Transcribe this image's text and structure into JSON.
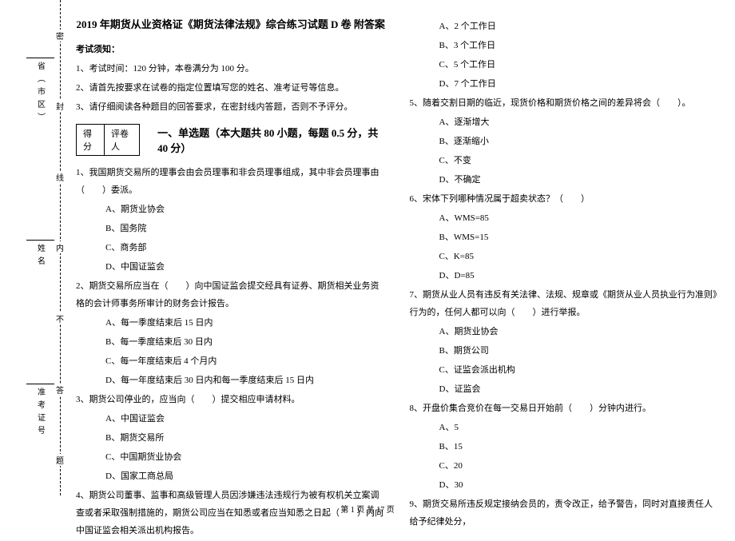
{
  "vertical_labels": {
    "province": "省（市区）",
    "name": "姓名",
    "ticket": "准考证号"
  },
  "fold_marks": [
    "密",
    "封",
    "线",
    "内",
    "不",
    "答",
    "题"
  ],
  "title": "2019 年期货从业资格证《期货法律法规》综合练习试题 D 卷 附答案",
  "notice_label": "考试须知：",
  "notices": [
    "1、考试时间：120 分钟，本卷满分为 100 分。",
    "2、请首先按要求在试卷的指定位置填写您的姓名、准考证号等信息。",
    "3、请仔细阅读各种题目的回答要求，在密封线内答题，否则不予评分。"
  ],
  "score": {
    "c1": "得分",
    "c2": "评卷人"
  },
  "section_title": "一、单选题（本大题共 80 小题，每题 0.5 分，共 40 分）",
  "left_items": [
    "1、我国期货交易所的理事会由会员理事和非会员理事组成，其中非会员理事由（　　）委派。",
    "　A、期货业协会",
    "　B、国务院",
    "　C、商务部",
    "　D、中国证监会",
    "2、期货交易所应当在（　　）向中国证监会提交经具有证券、期货相关业务资格的会计师事务所审计的财务会计报告。",
    "　A、每一季度结束后 15 日内",
    "　B、每一季度结束后 30 日内",
    "　C、每一年度结束后 4 个月内",
    "　D、每一年度结束后 30 日内和每一季度结束后 15 日内",
    "3、期货公司停业的，应当向（　　）提交相应申请材料。",
    "　A、中国证监会",
    "　B、期货交易所",
    "　C、中国期货业协会",
    "　D、国家工商总局",
    "4、期货公司董事、监事和高级管理人员因涉嫌违法违规行为被有权机关立案调查或者采取强制措施的，期货公司应当在知悉或者应当知悉之日起（　　）内向中国证监会相关派出机构报告。"
  ],
  "right_items": [
    "　A、2 个工作日",
    "　B、3 个工作日",
    "　C、5 个工作日",
    "　D、7 个工作日",
    "5、随着交割日期的临近，现货价格和期货价格之间的差异将会（　　）。",
    "　A、逐渐增大",
    "　B、逐渐缩小",
    "　C、不变",
    "　D、不确定",
    "6、宋体下列哪种情况属于超卖状态？（　　）",
    "　A、WMS=85",
    "　B、WMS=15",
    "　C、K=85",
    "　D、D=85",
    "7、期货从业人员有违反有关法律、法规、规章或《期货从业人员执业行为准则》行为的，任何人都可以向（　　）进行举报。",
    "　A、期货业协会",
    "　B、期货公司",
    "　C、证监会派出机构",
    "　D、证监会",
    "8、开盘价集合竞价在每一交易日开始前（　　）分钟内进行。",
    "　A、5",
    "　B、15",
    "　C、20",
    "　D、30",
    "9、期货交易所违反规定接纳会员的，责令改正，给予警告，同时对直接责任人给予纪律处分，"
  ],
  "footer": "第 1 页 共 17 页"
}
